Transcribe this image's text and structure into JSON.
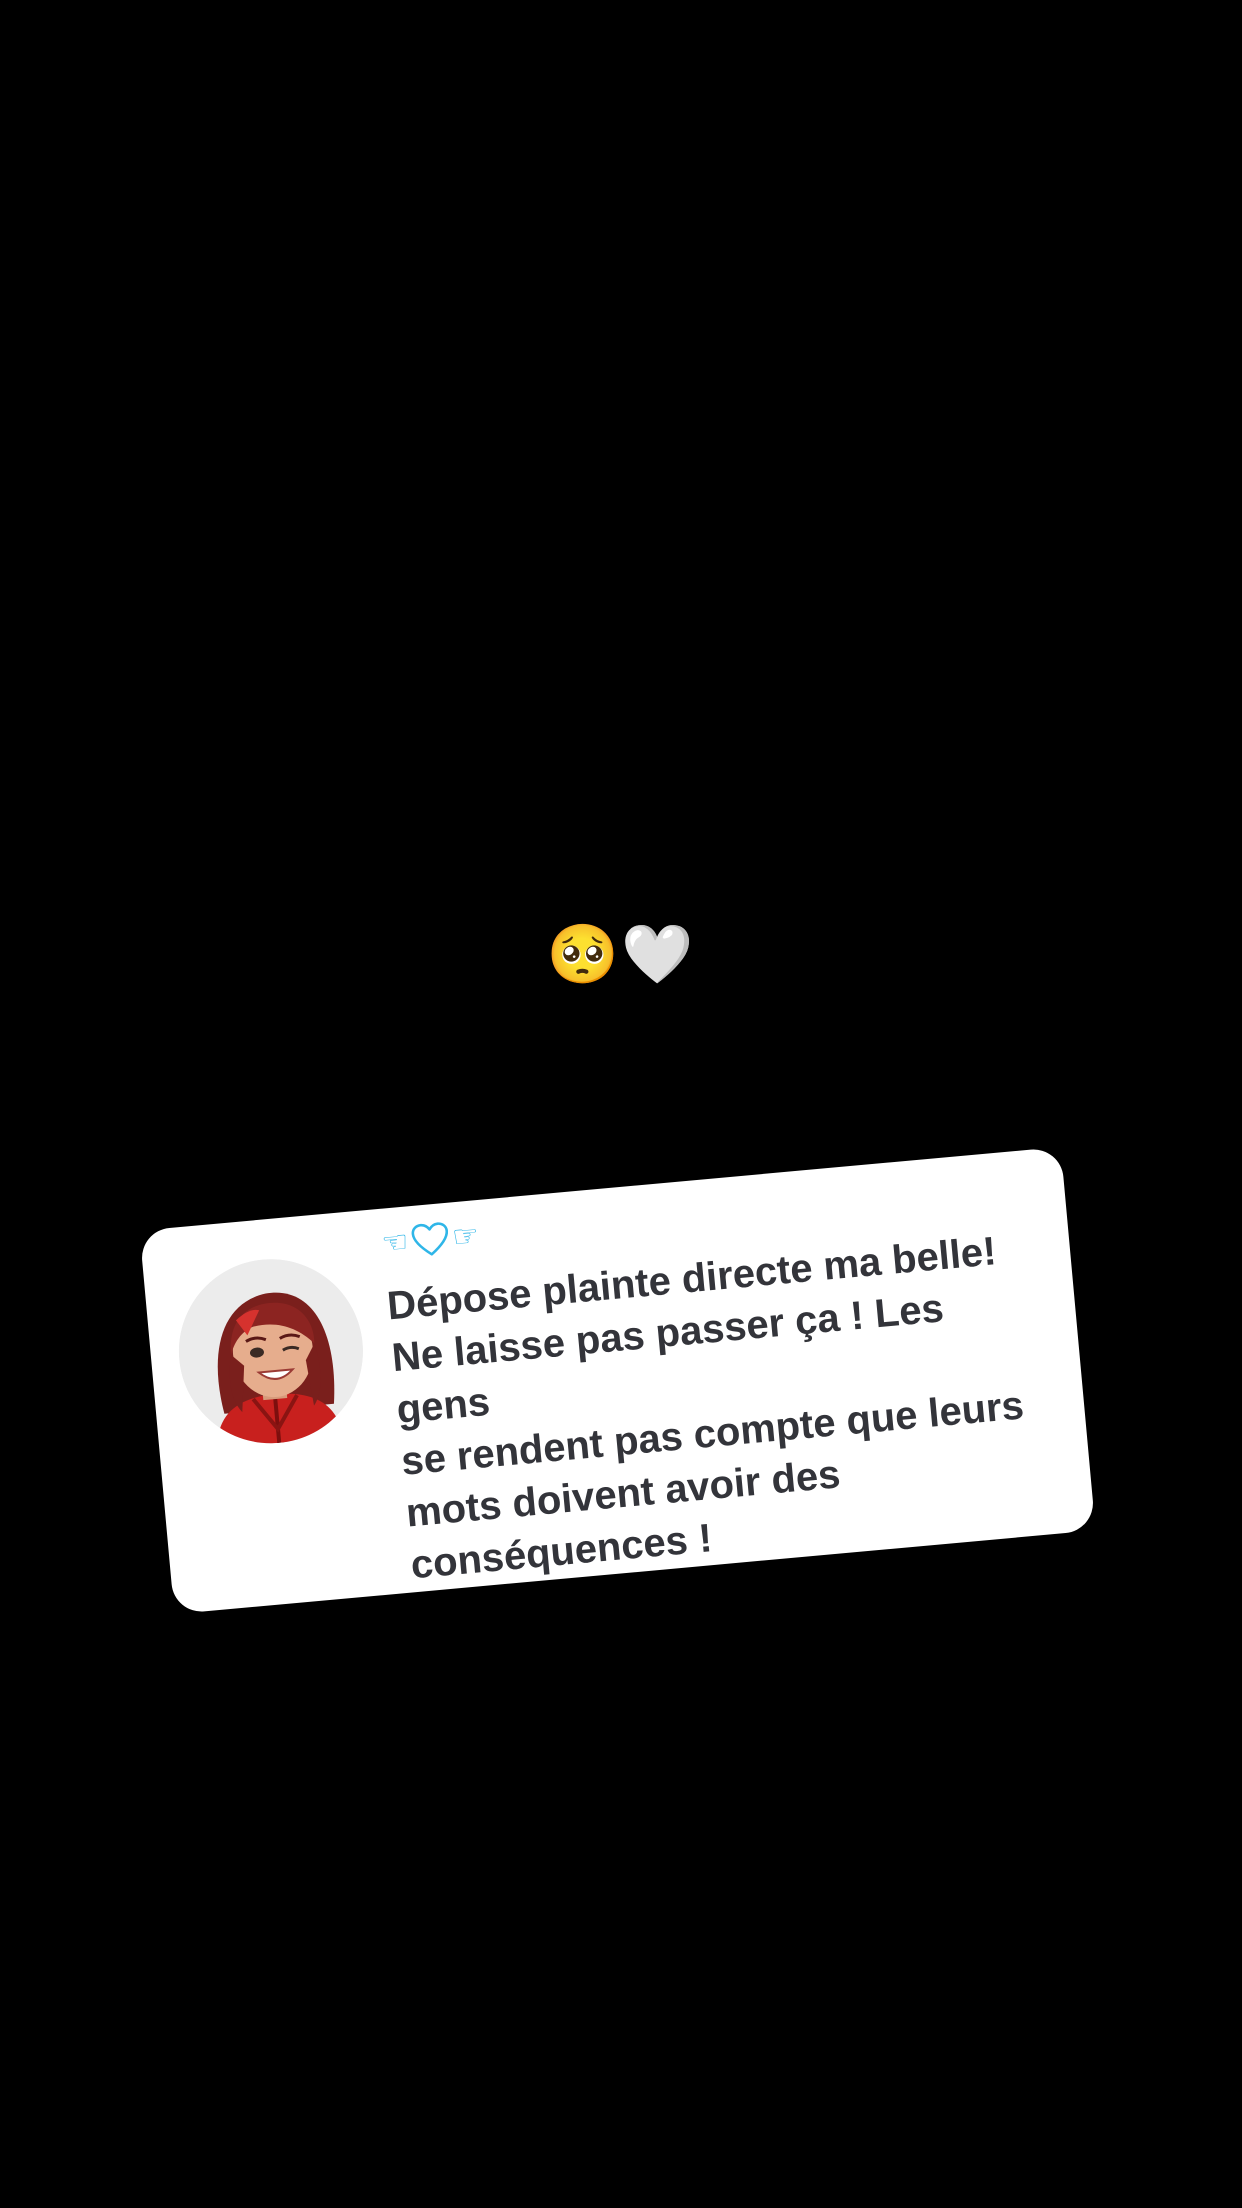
{
  "story": {
    "emoji_text": "🥺🤍"
  },
  "reply_card": {
    "avatar_icon": "bitmoji-avatar-icon",
    "username": {
      "left_hand": "☜",
      "heart_icon": "heart-outline-icon",
      "right_hand": "☞"
    },
    "message": "Dépose plainte directe ma belle!\nNe laisse pas passer ça ! Les gens\nse rendent pas compte que leurs\nmots doivent avoir des\nconséquences !"
  },
  "colors": {
    "background": "#000000",
    "card": "#ffffff",
    "text": "#33343a",
    "username_accent": "#2fb6e8"
  }
}
